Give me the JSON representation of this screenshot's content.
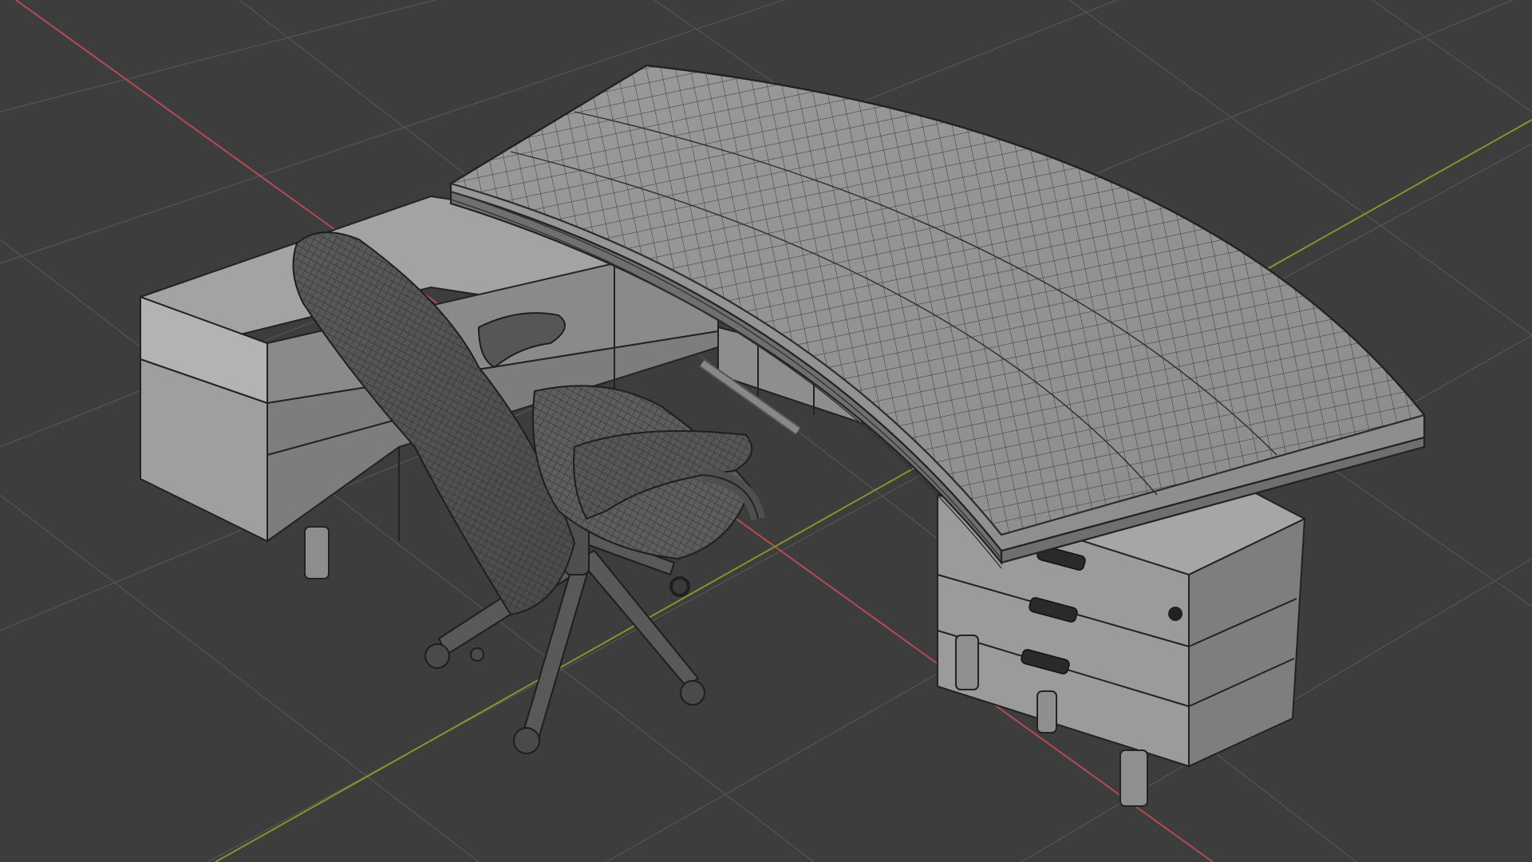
{
  "viewport": {
    "background": "#3d3d3d",
    "grid_color": "#555555",
    "axis_x_color": "#b54a55",
    "axis_y_color": "#7c9a2a",
    "overlay": "wireframe"
  },
  "scene": {
    "objects": [
      {
        "name": "executive-desk",
        "parts": [
          "curved-desktop",
          "side-return",
          "pedestal-drawers"
        ]
      },
      {
        "name": "office-chair",
        "parts": [
          "backrest",
          "armrests",
          "seat",
          "star-base",
          "casters"
        ]
      }
    ],
    "pedestal": {
      "drawer_count": 3
    },
    "chair": {
      "caster_count": 5
    }
  }
}
